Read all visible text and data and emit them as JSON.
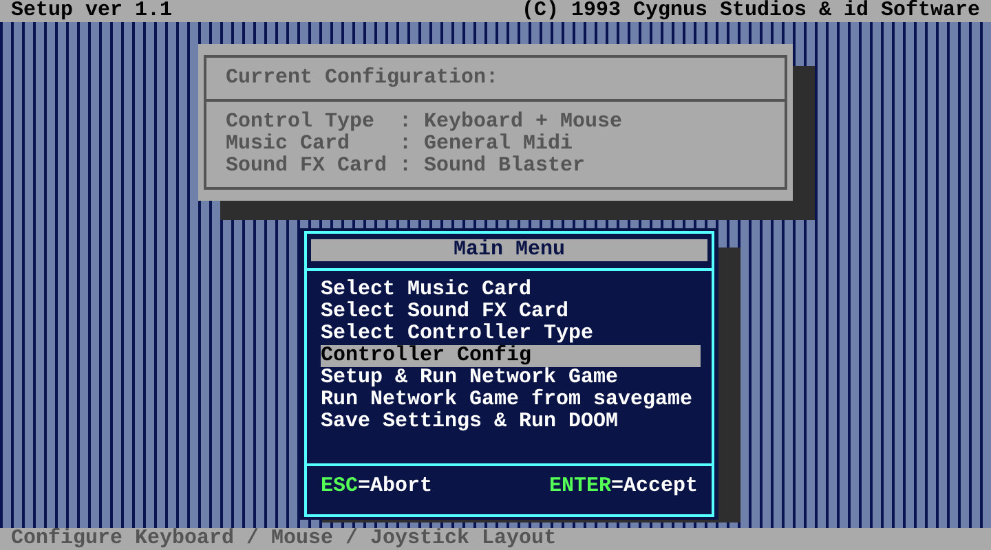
{
  "title_bar": {
    "left": "Setup ver 1.1",
    "right": "(C) 1993 Cygnus Studios & id Software"
  },
  "config_panel": {
    "title": "Current Configuration:",
    "rows": [
      "Control Type  : Keyboard + Mouse",
      "Music Card    : General Midi",
      "Sound FX Card : Sound Blaster"
    ]
  },
  "main_menu": {
    "title": "Main Menu",
    "items": [
      {
        "label": "Select Music Card",
        "selected": false
      },
      {
        "label": "Select Sound FX Card",
        "selected": false
      },
      {
        "label": "Select Controller Type",
        "selected": false
      },
      {
        "label": "Controller Config",
        "selected": true
      },
      {
        "label": "Setup & Run Network Game",
        "selected": false
      },
      {
        "label": "Run Network Game from savegame",
        "selected": false
      },
      {
        "label": "Save Settings & Run DOOM",
        "selected": false
      }
    ],
    "footer": [
      {
        "key": "ESC",
        "action": "=Abort"
      },
      {
        "key": "ENTER",
        "action": "=Accept"
      }
    ]
  },
  "status_bar": "Configure Keyboard / Mouse / Joystick Layout"
}
